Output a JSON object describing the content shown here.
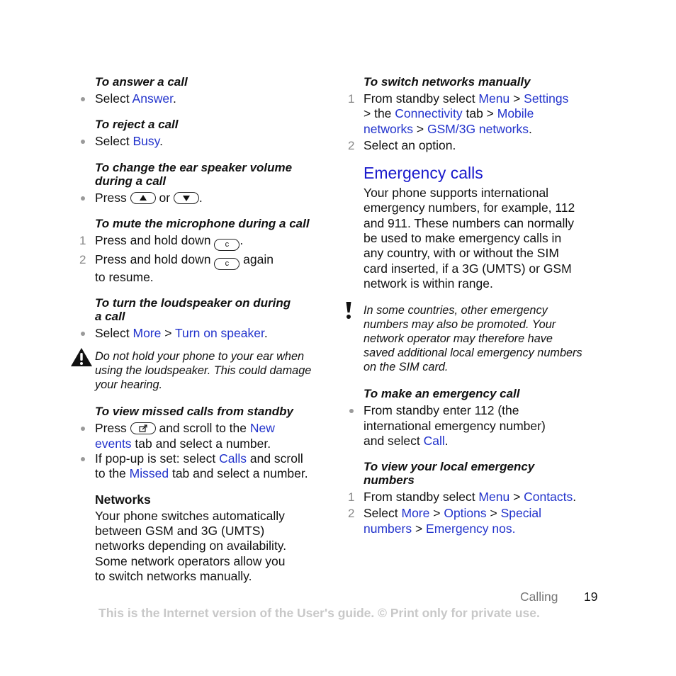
{
  "left": {
    "answer": {
      "heading": "To answer a call",
      "pre": "Select ",
      "link": "Answer",
      "post": "."
    },
    "reject": {
      "heading": "To reject a call",
      "pre": "Select ",
      "link": "Busy",
      "post": "."
    },
    "volume": {
      "heading_line1": "To change the ear speaker volume",
      "heading_line2": "during a call",
      "pre": "Press ",
      "mid": " or ",
      "post": "."
    },
    "mute": {
      "heading": "To mute the microphone during a call",
      "step1": {
        "num": "1",
        "pre": "Press and hold down ",
        "post": ".",
        "key": "c"
      },
      "step2": {
        "num": "2",
        "pre": "Press and hold down ",
        "post": " again",
        "line2": "to resume.",
        "key": "c"
      }
    },
    "speaker": {
      "heading_line1": "To turn the loudspeaker on during",
      "heading_line2": "a call",
      "pre": "Select ",
      "link1": "More",
      "sep": " > ",
      "link2": "Turn on speaker",
      "post": "."
    },
    "warning": {
      "line1": "Do not hold your phone to your ear when",
      "line2": "using the loudspeaker. This could damage",
      "line3": "your hearing."
    },
    "missed": {
      "heading": "To view missed calls from standby",
      "b1": {
        "pre": "Press ",
        "mid": " and scroll to the ",
        "link1": "New",
        "link1b": "events",
        "post": " tab and select a number."
      },
      "b2": {
        "pre": "If pop-up is set: select ",
        "link1": "Calls",
        "mid": " and scroll",
        "line2pre": "to the ",
        "link2": "Missed",
        "post": " tab and select a number."
      }
    },
    "networks": {
      "heading": "Networks",
      "lines": [
        "Your phone switches automatically",
        "between GSM and 3G (UMTS)",
        "networks depending on availability.",
        "Some network operators allow you",
        "to switch networks manually."
      ]
    }
  },
  "right": {
    "switch": {
      "heading": "To switch networks manually",
      "step1": {
        "num": "1",
        "pre": "From standby select ",
        "l1": "Menu",
        "sep": " > ",
        "l2": "Settings",
        "l2pre": "> the ",
        "l3": "Connectivity",
        "mid": " tab > ",
        "l4": "Mobile",
        "l5": "networks",
        "l6": "GSM/3G networks",
        "post": "."
      },
      "step2": {
        "num": "2",
        "text": "Select an option."
      }
    },
    "emergency": {
      "title": "Emergency calls",
      "lines": [
        "Your phone supports international",
        "emergency numbers, for example, 112",
        "and 911. These numbers can normally",
        "be used to make emergency calls in",
        "any country, with or without the SIM",
        "card inserted, if a 3G (UMTS) or GSM",
        "network is within range."
      ]
    },
    "note": {
      "lines": [
        "In some countries, other emergency",
        "numbers may also be promoted. Your",
        "network operator may therefore have",
        "saved additional local emergency numbers",
        "on the SIM card."
      ]
    },
    "make": {
      "heading": "To make an emergency call",
      "line1": "From standby enter 112 (the",
      "line2": "international emergency number)",
      "line3pre": "and select ",
      "link": "Call",
      "post": "."
    },
    "local": {
      "heading_line1": "To view your local emergency",
      "heading_line2": "numbers",
      "step1": {
        "num": "1",
        "pre": "From standby select ",
        "l1": "Menu",
        "sep": " > ",
        "l2": "Contacts",
        "post": "."
      },
      "step2": {
        "num": "2",
        "pre": "Select ",
        "l1": "More",
        "l2": "Options",
        "l3": "Special",
        "l4": "numbers",
        "l5": "Emergency nos."
      }
    }
  },
  "footer": {
    "section": "Calling",
    "page": "19",
    "disclaimer": "This is the Internet version of the User's guide. © Print only for private use."
  },
  "colors": {
    "link": "#2233cc",
    "heading": "#1a1acc",
    "disclaimer": "#c8c8c8"
  }
}
